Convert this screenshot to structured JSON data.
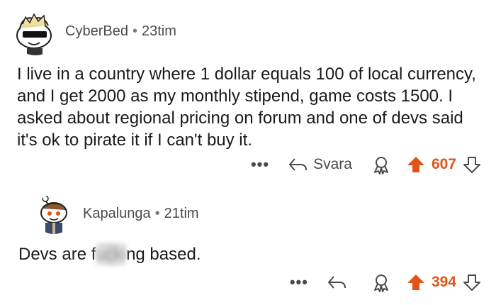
{
  "comments": [
    {
      "author": "CyberBed",
      "separator": "•",
      "time": "23tim",
      "body": "I live in a country where 1 dollar equals 100 of local currency, and I get 2000 as my monthly stipend, game costs 1500. I asked about regional pricing on forum and one of devs said it's ok to pirate it if I can't buy it.",
      "actions": {
        "more": "•••",
        "reply_label": "Svara",
        "score": "607"
      }
    },
    {
      "author": "Kapalunga",
      "separator": "•",
      "time": "21tim",
      "body_start": "Devs are f",
      "body_censored": "ucki",
      "body_end": "ng based.",
      "actions": {
        "more": "•••",
        "score": "394"
      }
    }
  ],
  "colors": {
    "upvote": "#e0541a",
    "text": "#1a1a1b",
    "meta": "#4a4a4a"
  },
  "icons": [
    "snoo-avatar-sunglasses",
    "snoo-avatar-jacket",
    "reply-arrow-icon",
    "award-icon",
    "upvote-icon",
    "downvote-icon",
    "more-icon"
  ]
}
